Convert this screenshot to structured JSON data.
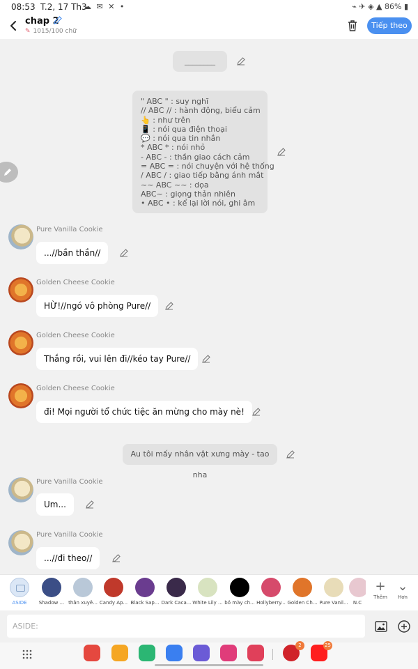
{
  "status_bar": {
    "time": "08:53",
    "date": "T.2, 17 Th3",
    "battery": "86%"
  },
  "header": {
    "title": "chap 2",
    "word_count": "1015/100 chữ",
    "next_label": "Tiếp theo"
  },
  "chat": {
    "system_notes": [
      {
        "text": "________"
      },
      {
        "lines": [
          "\" ABC \" : suy nghĩ",
          "// ABC // : hành động, biểu cảm",
          "👆 : như trên",
          "📱 : nói qua điện thoại",
          "💬 : nói qua tin nhắn",
          "* ABC * : nói nhỏ",
          "- ABC - : thần giao cách cảm",
          "= ABC = : nói chuyện với hệ thống",
          "/ ABC / : giao tiếp bằng ánh mắt",
          "~~ ABC ~~ : dọa",
          "ABC~ : giọng thản nhiên",
          "• ABC • : kể lại lời nói, ghi âm"
        ]
      },
      {
        "text": "Au tôi mấy nhân vật xưng mày - tao nha"
      }
    ],
    "messages": [
      {
        "sender": "Pure Vanilla Cookie",
        "text": "...//bần thần//"
      },
      {
        "sender": "Golden Cheese Cookie",
        "text": "HỪ!//ngó vô phòng Pure//"
      },
      {
        "sender": "Golden Cheese Cookie",
        "text": "Thắng rồi, vui lên đi//kéo tay Pure//"
      },
      {
        "sender": "Golden Cheese Cookie",
        "text": "đi! Mọi người tổ chức tiệc ăn mừng cho mày nè!"
      },
      {
        "sender": "Pure Vanilla Cookie",
        "text": "Um..."
      },
      {
        "sender": "Pure Vanilla Cookie",
        "text": "...//đi theo//"
      }
    ]
  },
  "characters": [
    {
      "label": "ASIDE",
      "color": "#dbe7f6"
    },
    {
      "label": "Shadow ...",
      "color": "#3b4e86"
    },
    {
      "label": "thân xuyê...",
      "color": "#b9c8d8"
    },
    {
      "label": "Candy Ap...",
      "color": "#c0392b"
    },
    {
      "label": "Black Sap...",
      "color": "#6a3c8f"
    },
    {
      "label": "Dark Caca...",
      "color": "#3a2a4a"
    },
    {
      "label": "White Lily ...",
      "color": "#d8e3c0"
    },
    {
      "label": "bỏ mày ch...",
      "color": "#000000"
    },
    {
      "label": "Hollyberry...",
      "color": "#d64a6b"
    },
    {
      "label": "Golden Ch...",
      "color": "#e0752a"
    },
    {
      "label": "Pure Vanil...",
      "color": "#e8dcb8"
    },
    {
      "label": "N.C",
      "color": "#e8c8d0"
    }
  ],
  "tools": {
    "add_label": "Thêm",
    "more_label": "Hơn"
  },
  "composer": {
    "placeholder": "ASIDE:"
  },
  "dock": {
    "apps": [
      {
        "name": "red-app",
        "color": "#e5483f",
        "badge": ""
      },
      {
        "name": "folder-app",
        "color": "#f5a623",
        "badge": ""
      },
      {
        "name": "phone-app",
        "color": "#2bb673",
        "badge": ""
      },
      {
        "name": "messages-app",
        "color": "#3a7ff0",
        "badge": ""
      },
      {
        "name": "internet-app",
        "color": "#6b5bd6",
        "badge": ""
      },
      {
        "name": "flower-app",
        "color": "#e03c7a",
        "badge": ""
      },
      {
        "name": "camera-app",
        "color": "#e0405a",
        "badge": ""
      },
      {
        "name": "pinterest-app",
        "color": "#d0232a",
        "badge": "2"
      },
      {
        "name": "youtube-app",
        "color": "#ff1e1e",
        "badge": "25"
      }
    ]
  }
}
